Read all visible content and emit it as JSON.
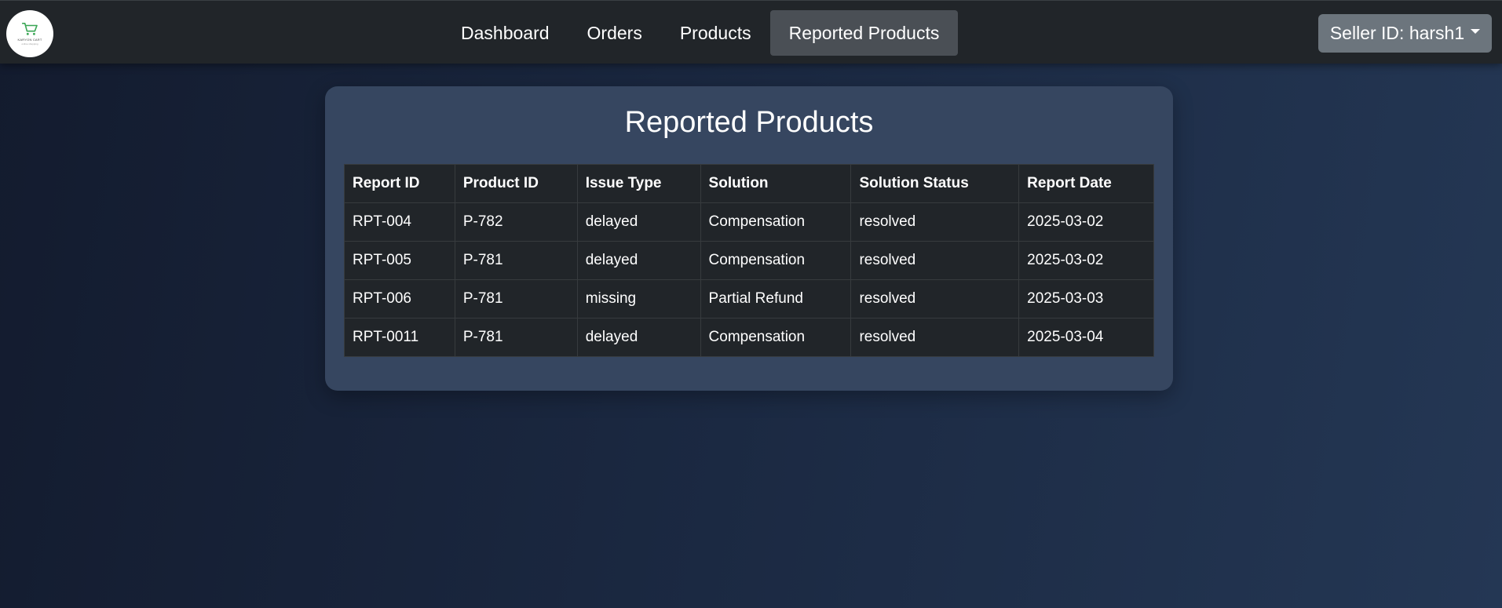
{
  "logo": {
    "text": "KARYON CART",
    "subtext": "online shopping",
    "icon": "shopping-cart-icon"
  },
  "nav": {
    "links": [
      "Dashboard",
      "Orders",
      "Products",
      "Reported Products"
    ],
    "active": "Reported Products"
  },
  "seller": {
    "label": "Seller ID: harsh1",
    "icon": "caret-down-icon"
  },
  "page": {
    "title": "Reported Products"
  },
  "table": {
    "headers": [
      "Report ID",
      "Product ID",
      "Issue Type",
      "Solution",
      "Solution Status",
      "Report Date"
    ],
    "rows": [
      [
        "RPT-004",
        "P-782",
        "delayed",
        "Compensation",
        "resolved",
        "2025-03-02"
      ],
      [
        "RPT-005",
        "P-781",
        "delayed",
        "Compensation",
        "resolved",
        "2025-03-02"
      ],
      [
        "RPT-006",
        "P-781",
        "missing",
        "Partial Refund",
        "resolved",
        "2025-03-03"
      ],
      [
        "RPT-0011",
        "P-781",
        "delayed",
        "Compensation",
        "resolved",
        "2025-03-04"
      ]
    ]
  },
  "colors": {
    "navbar": "#212529",
    "active_tab": "#4a4f55",
    "seller_button": "#6c757d",
    "card": "#364660",
    "table_bg": "#212529"
  }
}
